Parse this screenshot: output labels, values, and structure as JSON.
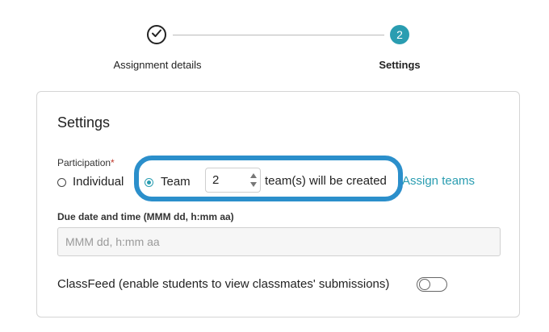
{
  "stepper": {
    "steps": [
      {
        "label": "Assignment details",
        "state": "complete",
        "icon": "check-icon"
      },
      {
        "label": "Settings",
        "number": "2",
        "state": "current"
      }
    ]
  },
  "card": {
    "title": "Settings",
    "participation": {
      "label": "Participation",
      "required_mark": "*",
      "options": [
        {
          "label": "Individual",
          "selected": false
        },
        {
          "label": "Team",
          "selected": true
        }
      ],
      "team_count": "2",
      "team_count_suffix": "team(s) will be created",
      "assign_link": "Assign teams"
    },
    "due": {
      "label": "Due date and time (MMM dd, h:mm aa)",
      "placeholder": "MMM dd, h:mm aa"
    },
    "classfeed": {
      "label": "ClassFeed (enable students to view classmates' submissions)",
      "enabled": false
    }
  },
  "colors": {
    "accent": "#2a9db1",
    "highlight": "#2b8fcb"
  }
}
